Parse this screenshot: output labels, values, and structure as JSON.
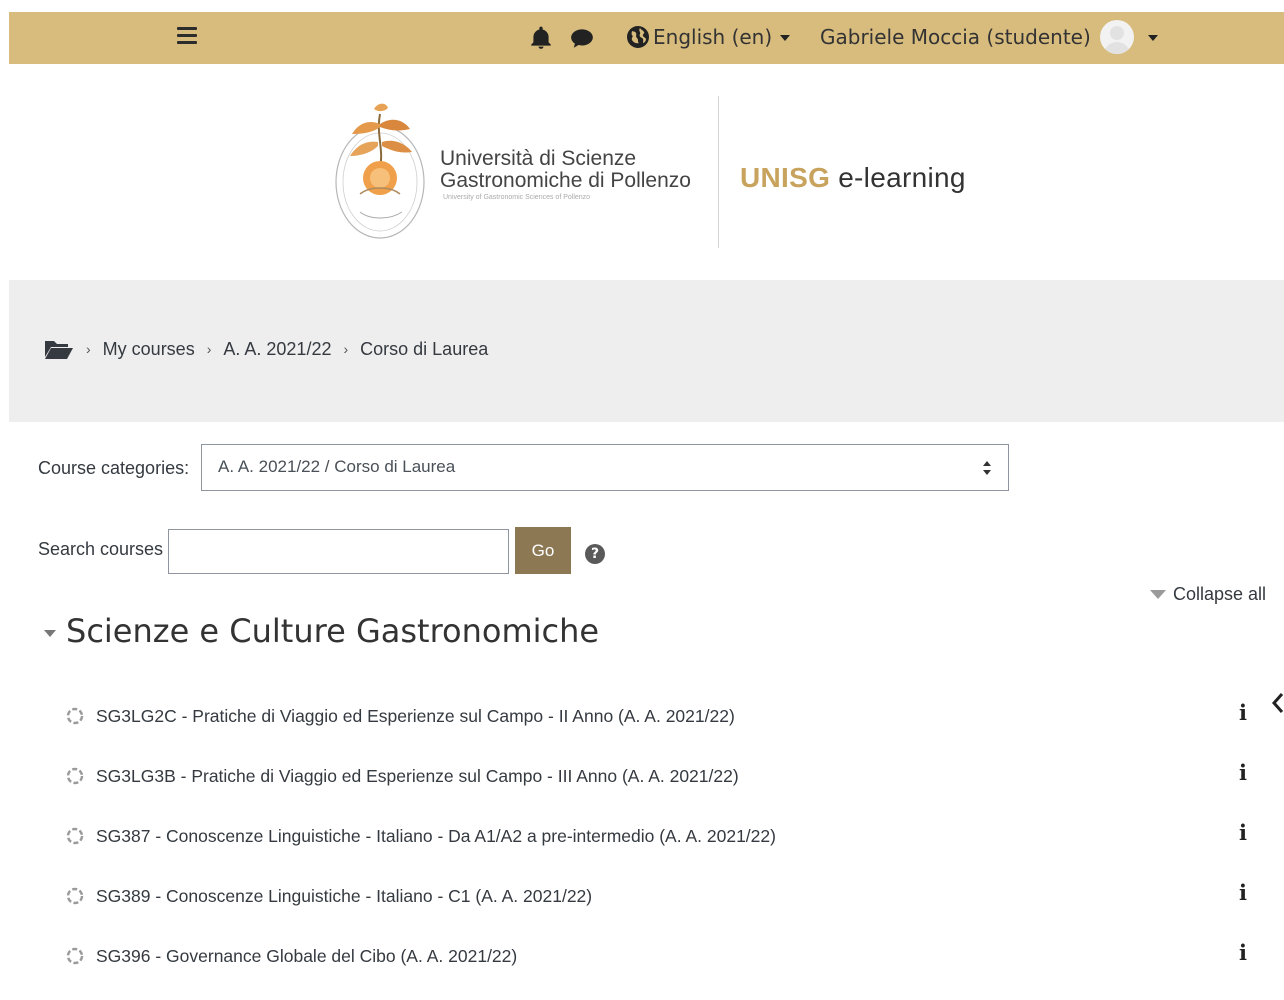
{
  "navbar": {
    "language": "English (en)",
    "user_name": "Gabriele Moccia (studente)"
  },
  "header": {
    "university_line1": "Università di Scienze",
    "university_line2": "Gastronomiche di Pollenzo",
    "university_subtitle": "University of Gastronomic Sciences of Pollenzo",
    "platform_brand": "UNISG",
    "platform_name": "e-learning"
  },
  "breadcrumb": {
    "items": [
      "My courses",
      "A. A. 2021/22",
      "Corso di Laurea"
    ]
  },
  "filters": {
    "category_label": "Course categories:",
    "category_selected": "A. A. 2021/22 / Corso di Laurea",
    "search_label": "Search courses",
    "search_value": "",
    "go_label": "Go",
    "help_glyph": "?"
  },
  "category": {
    "collapse_all": "Collapse all",
    "title": "Scienze e Culture Gastronomiche",
    "courses": [
      "SG3LG2C - Pratiche di Viaggio ed Esperienze sul Campo - II Anno (A. A. 2021/22)",
      "SG3LG3B - Pratiche di Viaggio ed Esperienze sul Campo - III Anno (A. A. 2021/22)",
      "SG387 - Conoscenze Linguistiche - Italiano - Da A1/A2 a pre-intermedio (A. A. 2021/22)",
      "SG389 - Conoscenze Linguistiche - Italiano - C1 (A. A. 2021/22)",
      "SG396 - Governance Globale del Cibo (A. A. 2021/22)"
    ],
    "info_glyph": "i"
  },
  "colors": {
    "navbar": "#d8bc7e",
    "brand_gold": "#c7a35d",
    "go_button": "#8c7853",
    "band": "#eeeeee"
  },
  "icons": [
    "menu-icon",
    "bell-icon",
    "chat-icon",
    "globe-icon",
    "avatar-icon",
    "folder-icon",
    "course-icon",
    "info-icon",
    "help-icon"
  ]
}
